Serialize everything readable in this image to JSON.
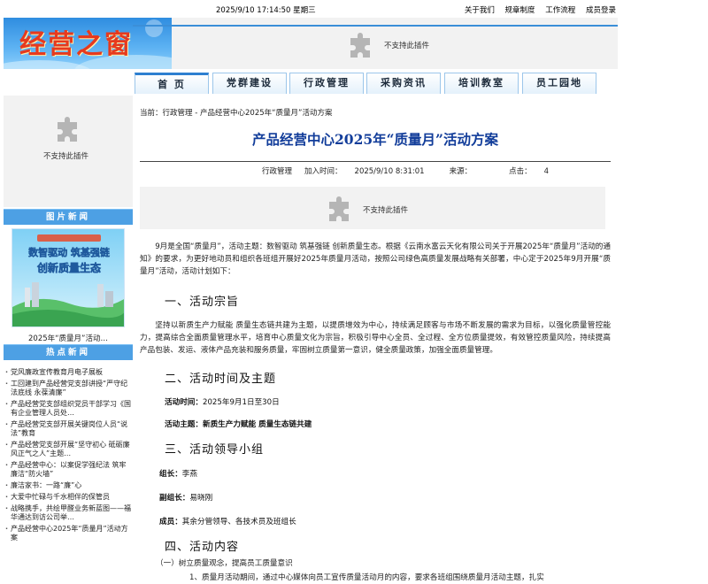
{
  "topbar": {
    "datetime": "2025/9/10  17:14:50  星期三",
    "links": [
      "关于我们",
      "规章制度",
      "工作流程",
      "成员登录"
    ]
  },
  "banner": {
    "title": "经营之窗",
    "plugin_text": "不支持此插件"
  },
  "nav": {
    "items": [
      "首  页",
      "党群建设",
      "行政管理",
      "采购资讯",
      "培训教室",
      "员工园地"
    ]
  },
  "sidebar": {
    "plugin_text": "不支持此插件",
    "photo_news": {
      "title": "图片新闻",
      "poster_lines": [
        "数智驱动 筑基强链",
        "创新质量生态"
      ],
      "caption": "2025年“质量月”活动…"
    },
    "hot_news": {
      "title": "热点新闻",
      "items": [
        "党风廉政宣传教育月电子展板",
        "工回建到产品经营党支部讲授“严守纪法底线 永葆清廉”",
        "产品经营党支部组织党员干部学习《国有企业管理人员处…",
        "产品经营党支部开展关键岗位人员“说法”教育",
        "产品经营党支部开展“坚守初心 砥砺廉风正气之人”主题…",
        "产品经营中心：以案促学强纪法 筑牢廉洁“防火墙”",
        "廉洁家书：一路“廉”心",
        "大爱中忙碌与千水相伴的保管员",
        "战略携手，共绘甲醛业务新蓝图——福华通达到访公司举…",
        "产品经营中心2025年“质量月”活动方案"
      ]
    }
  },
  "breadcrumb": {
    "label": "当前：",
    "items": [
      "行政管理",
      "产品经营中心2025年“质量月”活动方案"
    ],
    "sep": " - "
  },
  "article": {
    "title": "产品经营中心2025年“质量月”活动方案",
    "meta": {
      "category": "行政管理",
      "added_label": "加入时间：",
      "added_value": "2025/9/10  8:31:01",
      "source_label": "来源：",
      "source_value": "",
      "hits_label": "点击：",
      "hits_value": "4"
    },
    "plugin_text": "不支持此插件",
    "intro": "9月是全国“质量月”，活动主题：数智驱动 筑基强链 创新质量生态。根据《云南水富云天化有限公司关于开展2025年“质量月”活动的通知》的要求，为更好地动员和组织各班组开展好2025年质量月活动，按照公司绿色高质量发展战略有关部署，中心定于2025年9月开展“质量月”活动，活动计划如下：",
    "section1_title": "一、活动宗旨",
    "section1_text": "坚持以新质生产力赋能 质量生态链共建为主题，以提质增效为中心，持续满足顾客与市场不断发展的需求为目标，以强化质量管控能力，提高综合全面质量管理水平，培育中心质量文化为宗旨，积极引导中心全员、全过程、全方位质量提效，有效管控质量风险，持续提高产品包装、发运、液体产品充装和服务质量，牢固树立质量第一意识，健全质量政策，加强全面质量管理。",
    "section2_title": "二、活动时间及主题",
    "time_label": "活动时间：",
    "time_value": "2025年9月1日至30日",
    "theme_label": "活动主题：",
    "theme_value": "新质生产力赋能 质量生态链共建",
    "section3_title": "三、活动领导小组",
    "leader_label": "组长：",
    "leader_value": "李燕",
    "deputy_label": "副组长：",
    "deputy_value": "易晓刚",
    "members_label": "成员：",
    "members_value": "其余分管领导、各技术员及班组长",
    "section4_title": "四、活动内容",
    "sub1": "（一）树立质量观念，提高员工质量意识",
    "sub1_item": "1、质量月活动期间，通过中心媒体向员工宣传质量活动月的内容，要求各班组围绕质量月活动主题，扎实"
  },
  "colors": {
    "title_blue": "#123d9a",
    "banner_red": "#e63a1e",
    "section_head_blue": "#4da0e4"
  }
}
